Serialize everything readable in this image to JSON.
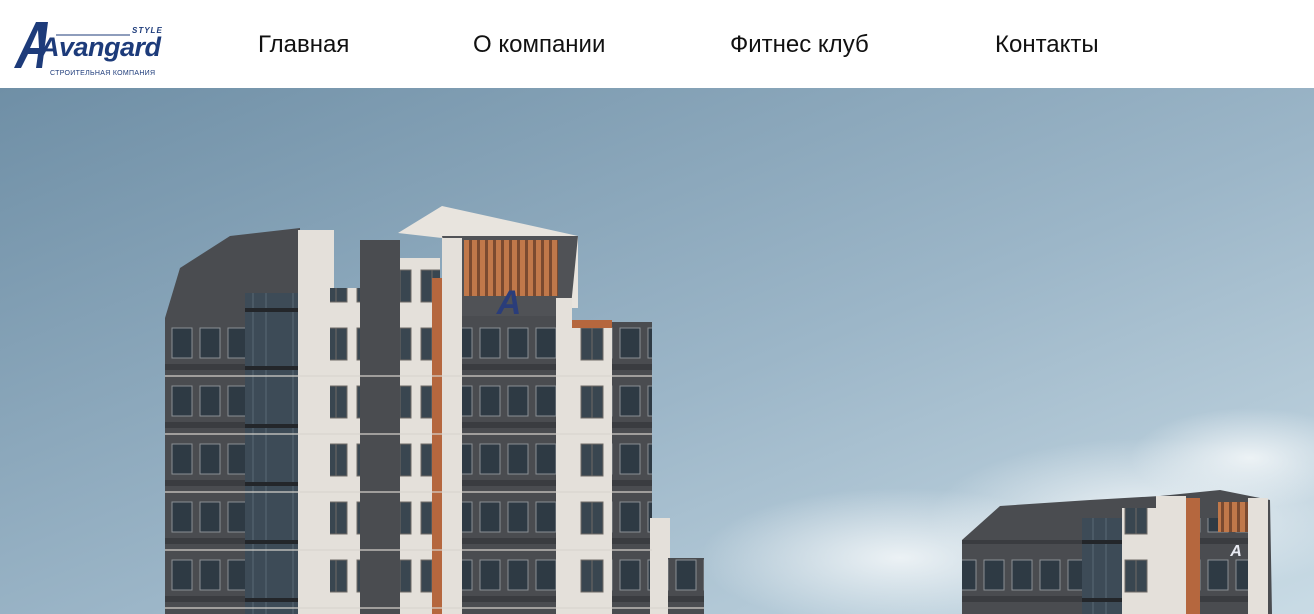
{
  "header": {
    "logo": {
      "wordmark": "Avangard",
      "style_tag": "STYLE",
      "tagline": "СТРОИТЕЛЬНАЯ КОМПАНИЯ",
      "color": "#1d3b7a"
    },
    "nav": [
      {
        "label": "Главная"
      },
      {
        "label": "О компании"
      },
      {
        "label": "Фитнес клуб"
      },
      {
        "label": "Контакты"
      }
    ]
  },
  "hero": {
    "sky_top": "#7e9cb1",
    "sky_bottom": "#b9d0de",
    "facade_light": "#e6e2dc",
    "facade_dark": "#4c4e52",
    "accent_wood": "#b5673e",
    "roof_logo_letter": "A"
  }
}
